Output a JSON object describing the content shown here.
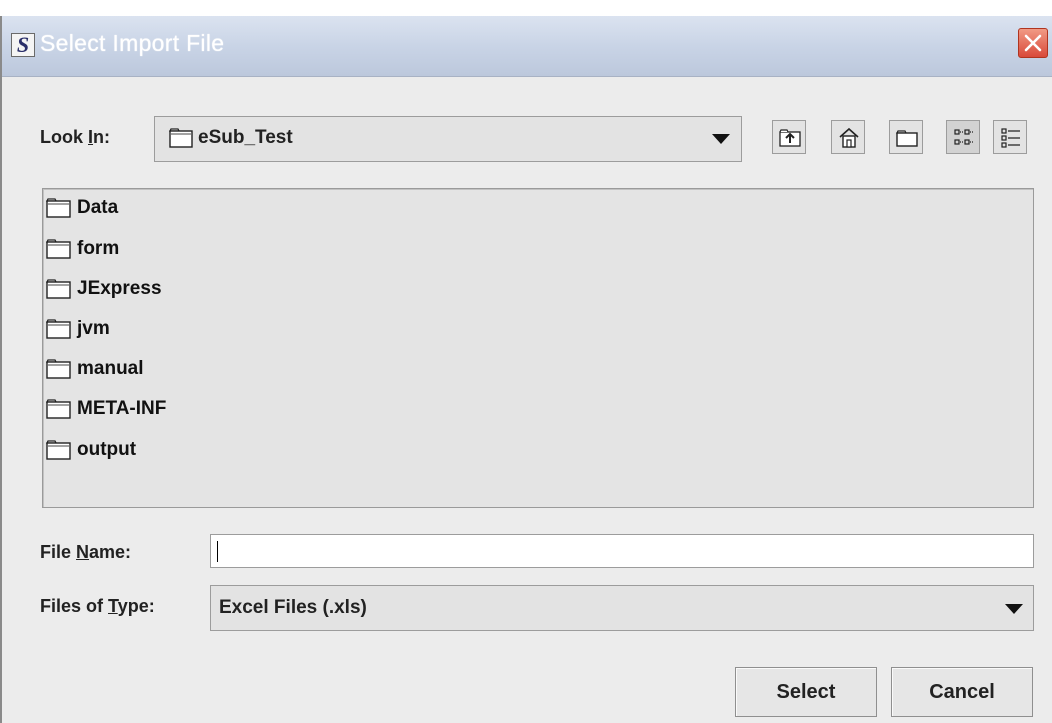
{
  "window": {
    "title": "Select Import File"
  },
  "look_in": {
    "label_before": "Look ",
    "label_mnemonic": "I",
    "label_after": "n:",
    "value": "eSub_Test"
  },
  "toolbar": {
    "icons": [
      "up-one-level-icon",
      "home-icon",
      "new-folder-icon",
      "list-view-icon",
      "details-view-icon"
    ]
  },
  "file_list": {
    "items": [
      {
        "name": "Data",
        "type": "folder"
      },
      {
        "name": "form",
        "type": "folder"
      },
      {
        "name": "JExpress",
        "type": "folder"
      },
      {
        "name": "jvm",
        "type": "folder"
      },
      {
        "name": "manual",
        "type": "folder"
      },
      {
        "name": "META-INF",
        "type": "folder"
      },
      {
        "name": "output",
        "type": "folder"
      }
    ]
  },
  "file_name": {
    "label_before": "File ",
    "label_mnemonic": "N",
    "label_after": "ame:",
    "value": ""
  },
  "files_of_type": {
    "label_before": "Files of ",
    "label_mnemonic": "T",
    "label_after": "ype:",
    "value": "Excel Files (.xls)"
  },
  "buttons": {
    "select": "Select",
    "cancel": "Cancel"
  },
  "colors": {
    "titlebar": "#c9d4e6",
    "dialog_bg": "#ececec",
    "close": "#d9493a"
  }
}
